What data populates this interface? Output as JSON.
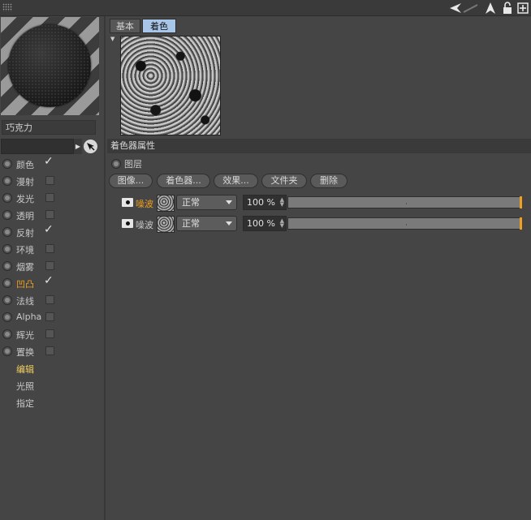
{
  "topbar": {
    "grip_icon": "grip-icon",
    "icons": [
      "back-arrow-icon",
      "navigate-arrow-icon",
      "lock-icon",
      "new-window-icon"
    ]
  },
  "material": {
    "name": "巧克力",
    "preview_icon": "material-sphere-preview"
  },
  "channels": [
    {
      "label": "颜色",
      "checked": true,
      "active": false
    },
    {
      "label": "漫射",
      "checked": false,
      "active": false
    },
    {
      "label": "发光",
      "checked": false,
      "active": false
    },
    {
      "label": "透明",
      "checked": false,
      "active": false
    },
    {
      "label": "反射",
      "checked": true,
      "active": false
    },
    {
      "label": "环境",
      "checked": false,
      "active": false
    },
    {
      "label": "烟雾",
      "checked": false,
      "active": false
    },
    {
      "label": "凹凸",
      "checked": true,
      "active": true
    },
    {
      "label": "法线",
      "checked": false,
      "active": false
    },
    {
      "label": "Alpha",
      "checked": false,
      "active": false
    },
    {
      "label": "辉光",
      "checked": false,
      "active": false
    },
    {
      "label": "置换",
      "checked": false,
      "active": false
    }
  ],
  "sublinks": [
    {
      "label": "编辑",
      "active": true
    },
    {
      "label": "光照",
      "active": false
    },
    {
      "label": "指定",
      "active": false
    }
  ],
  "tabs": [
    {
      "label": "基本",
      "selected": false
    },
    {
      "label": "着色器",
      "selected": true
    }
  ],
  "section": {
    "title": "着色器属性",
    "layer_label": "图层"
  },
  "buttons": [
    "图像...",
    "着色器...",
    "效果...",
    "文件夹",
    "删除"
  ],
  "layers": [
    {
      "name": "噪波",
      "highlighted": true,
      "mode": "正常",
      "opacity": "100 %",
      "slider_fraction": 1.0
    },
    {
      "name": "噪波",
      "highlighted": false,
      "mode": "正常",
      "opacity": "100 %",
      "slider_fraction": 1.0
    }
  ],
  "colors": {
    "accent_orange": "#f0a020",
    "accent_yellow": "#f2d060",
    "selected_tab": "#a9c5e8",
    "background": "#454545"
  }
}
